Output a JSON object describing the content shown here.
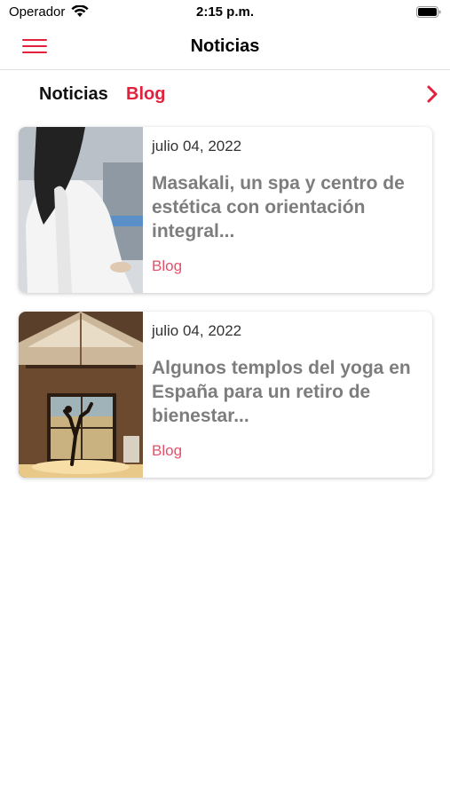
{
  "status_bar": {
    "carrier": "Operador",
    "time": "2:15 p.m."
  },
  "header": {
    "title": "Noticias",
    "menu_icon": "hamburger-menu-icon",
    "accent_color": "#e3213e"
  },
  "tabs": [
    {
      "label": "Noticias",
      "active": false
    },
    {
      "label": "Blog",
      "active": true
    }
  ],
  "posts": [
    {
      "date": "julio 04, 2022",
      "title": "Masakali, un spa y centro de estética con orientación integral...",
      "category": "Blog",
      "image": "woman-in-white-coat-photo"
    },
    {
      "date": "julio 04, 2022",
      "title": "Algunos templos del yoga en España para un retiro de bienestar...",
      "category": "Blog",
      "image": "yoga-pose-wooden-building-photo"
    }
  ]
}
